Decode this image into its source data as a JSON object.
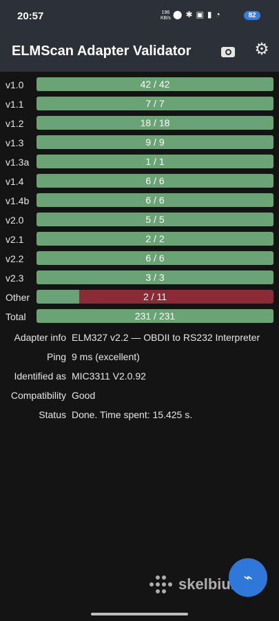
{
  "statusbar": {
    "time": "20:57",
    "netspeed_top": "196",
    "netspeed_bottom": "KB/s",
    "battery": "82",
    "icons": [
      "location-icon",
      "bluetooth-icon",
      "volte-icon",
      "signal-4g-icon",
      "wifi-icon"
    ]
  },
  "appbar": {
    "title": "ELMScan Adapter Validator"
  },
  "colors": {
    "pass": "#6aa474",
    "fail": "#8b2b35",
    "fab": "#2f78d9",
    "appbar": "#2b3136"
  },
  "rows": [
    {
      "label": "v1.0",
      "text": "42 / 42",
      "fraction": 1.0
    },
    {
      "label": "v1.1",
      "text": "7 / 7",
      "fraction": 1.0
    },
    {
      "label": "v1.2",
      "text": "18 / 18",
      "fraction": 1.0
    },
    {
      "label": "v1.3",
      "text": "9 / 9",
      "fraction": 1.0
    },
    {
      "label": "v1.3a",
      "text": "1 / 1",
      "fraction": 1.0
    },
    {
      "label": "v1.4",
      "text": "6 / 6",
      "fraction": 1.0
    },
    {
      "label": "v1.4b",
      "text": "6 / 6",
      "fraction": 1.0
    },
    {
      "label": "v2.0",
      "text": "5 / 5",
      "fraction": 1.0
    },
    {
      "label": "v2.1",
      "text": "2 / 2",
      "fraction": 1.0
    },
    {
      "label": "v2.2",
      "text": "6 / 6",
      "fraction": 1.0
    },
    {
      "label": "v2.3",
      "text": "3 / 3",
      "fraction": 1.0
    },
    {
      "label": "Other",
      "text": "2 / 11",
      "fraction": 0.18
    },
    {
      "label": "Total",
      "text": "231 / 231",
      "fraction": 1.0
    }
  ],
  "info": [
    {
      "key": "Adapter info",
      "value": "ELM327 v2.2 — OBDII to RS232 Interpreter"
    },
    {
      "key": "Ping",
      "value": "9 ms (excellent)"
    },
    {
      "key": "Identified as",
      "value": "MIC3311 V2.0.92"
    },
    {
      "key": "Compatibility",
      "value": "Good"
    },
    {
      "key": "Status",
      "value": "Done. Time spent: 15.425 s."
    }
  ],
  "watermark": {
    "text": "skelbiu.lt"
  }
}
